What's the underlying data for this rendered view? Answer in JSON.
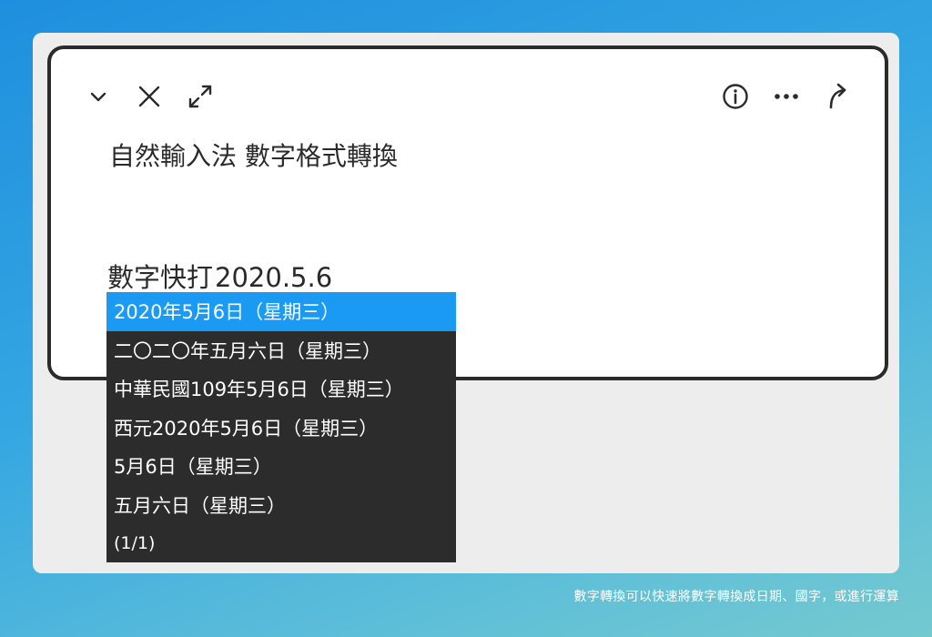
{
  "toolbar": {
    "left_icons": [
      "chevron-down-icon",
      "close-icon",
      "expand-icon"
    ],
    "right_icons": [
      "info-icon",
      "more-icon",
      "share-icon"
    ],
    "icon_color": "#2b2b2b"
  },
  "note": {
    "title": "自然輸入法 數字格式轉換",
    "composing_segments": [
      "數字快打",
      "2020.5.6"
    ]
  },
  "candidates": {
    "items": [
      "2020年5月6日（星期三）",
      "二〇二〇年五月六日（星期三）",
      "中華民國109年5月6日（星期三）",
      "西元2020年5月6日（星期三）",
      "5月6日（星期三）",
      "五月六日（星期三）"
    ],
    "selected_index": 0,
    "page_indicator": "(1/1)",
    "selected_color": "#1b9af4",
    "background_color": "#2c2c2c"
  },
  "caption": "數字轉換可以快速將數字轉換成日期、國字，或進行運算"
}
